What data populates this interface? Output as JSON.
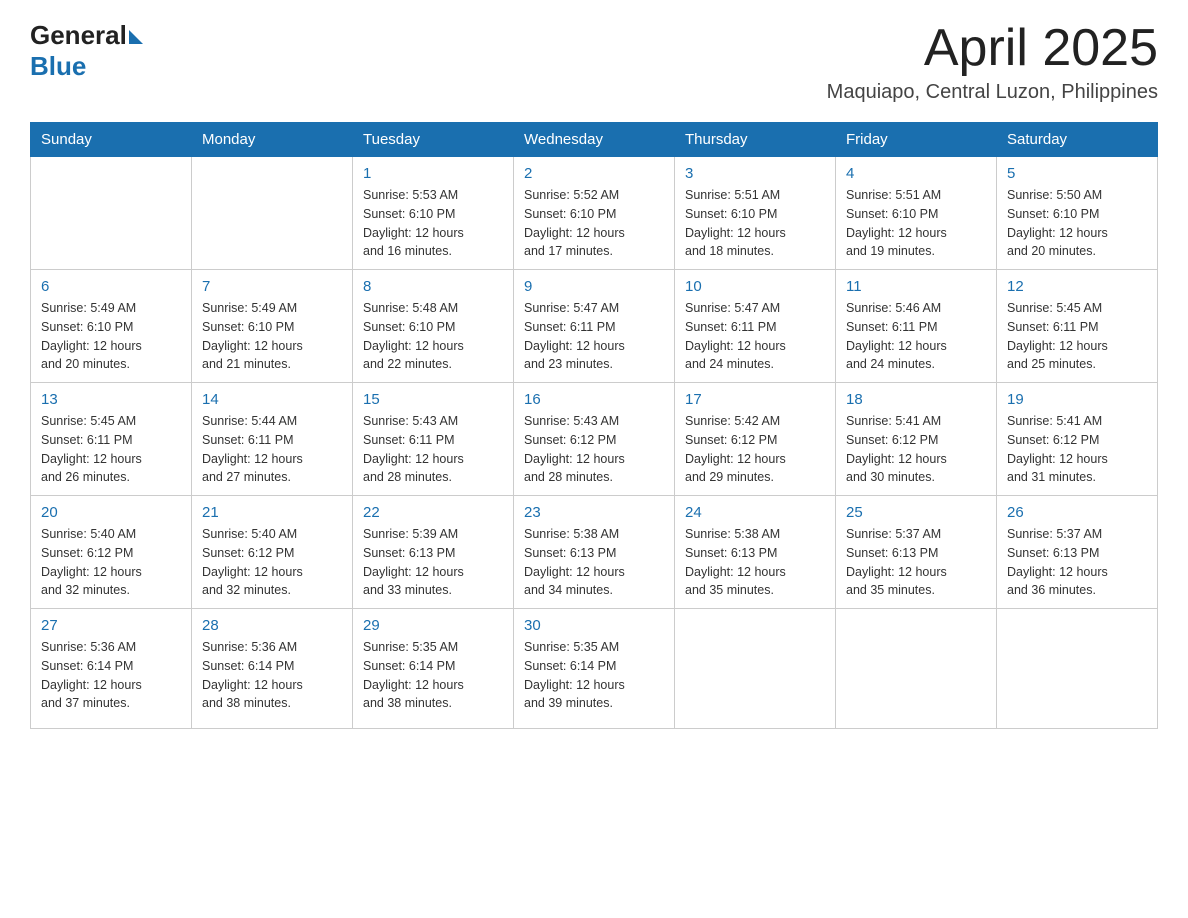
{
  "header": {
    "logo_general": "General",
    "logo_blue": "Blue",
    "month": "April 2025",
    "location": "Maquiapo, Central Luzon, Philippines"
  },
  "weekdays": [
    "Sunday",
    "Monday",
    "Tuesday",
    "Wednesday",
    "Thursday",
    "Friday",
    "Saturday"
  ],
  "weeks": [
    [
      {
        "day": "",
        "info": ""
      },
      {
        "day": "",
        "info": ""
      },
      {
        "day": "1",
        "info": "Sunrise: 5:53 AM\nSunset: 6:10 PM\nDaylight: 12 hours\nand 16 minutes."
      },
      {
        "day": "2",
        "info": "Sunrise: 5:52 AM\nSunset: 6:10 PM\nDaylight: 12 hours\nand 17 minutes."
      },
      {
        "day": "3",
        "info": "Sunrise: 5:51 AM\nSunset: 6:10 PM\nDaylight: 12 hours\nand 18 minutes."
      },
      {
        "day": "4",
        "info": "Sunrise: 5:51 AM\nSunset: 6:10 PM\nDaylight: 12 hours\nand 19 minutes."
      },
      {
        "day": "5",
        "info": "Sunrise: 5:50 AM\nSunset: 6:10 PM\nDaylight: 12 hours\nand 20 minutes."
      }
    ],
    [
      {
        "day": "6",
        "info": "Sunrise: 5:49 AM\nSunset: 6:10 PM\nDaylight: 12 hours\nand 20 minutes."
      },
      {
        "day": "7",
        "info": "Sunrise: 5:49 AM\nSunset: 6:10 PM\nDaylight: 12 hours\nand 21 minutes."
      },
      {
        "day": "8",
        "info": "Sunrise: 5:48 AM\nSunset: 6:10 PM\nDaylight: 12 hours\nand 22 minutes."
      },
      {
        "day": "9",
        "info": "Sunrise: 5:47 AM\nSunset: 6:11 PM\nDaylight: 12 hours\nand 23 minutes."
      },
      {
        "day": "10",
        "info": "Sunrise: 5:47 AM\nSunset: 6:11 PM\nDaylight: 12 hours\nand 24 minutes."
      },
      {
        "day": "11",
        "info": "Sunrise: 5:46 AM\nSunset: 6:11 PM\nDaylight: 12 hours\nand 24 minutes."
      },
      {
        "day": "12",
        "info": "Sunrise: 5:45 AM\nSunset: 6:11 PM\nDaylight: 12 hours\nand 25 minutes."
      }
    ],
    [
      {
        "day": "13",
        "info": "Sunrise: 5:45 AM\nSunset: 6:11 PM\nDaylight: 12 hours\nand 26 minutes."
      },
      {
        "day": "14",
        "info": "Sunrise: 5:44 AM\nSunset: 6:11 PM\nDaylight: 12 hours\nand 27 minutes."
      },
      {
        "day": "15",
        "info": "Sunrise: 5:43 AM\nSunset: 6:11 PM\nDaylight: 12 hours\nand 28 minutes."
      },
      {
        "day": "16",
        "info": "Sunrise: 5:43 AM\nSunset: 6:12 PM\nDaylight: 12 hours\nand 28 minutes."
      },
      {
        "day": "17",
        "info": "Sunrise: 5:42 AM\nSunset: 6:12 PM\nDaylight: 12 hours\nand 29 minutes."
      },
      {
        "day": "18",
        "info": "Sunrise: 5:41 AM\nSunset: 6:12 PM\nDaylight: 12 hours\nand 30 minutes."
      },
      {
        "day": "19",
        "info": "Sunrise: 5:41 AM\nSunset: 6:12 PM\nDaylight: 12 hours\nand 31 minutes."
      }
    ],
    [
      {
        "day": "20",
        "info": "Sunrise: 5:40 AM\nSunset: 6:12 PM\nDaylight: 12 hours\nand 32 minutes."
      },
      {
        "day": "21",
        "info": "Sunrise: 5:40 AM\nSunset: 6:12 PM\nDaylight: 12 hours\nand 32 minutes."
      },
      {
        "day": "22",
        "info": "Sunrise: 5:39 AM\nSunset: 6:13 PM\nDaylight: 12 hours\nand 33 minutes."
      },
      {
        "day": "23",
        "info": "Sunrise: 5:38 AM\nSunset: 6:13 PM\nDaylight: 12 hours\nand 34 minutes."
      },
      {
        "day": "24",
        "info": "Sunrise: 5:38 AM\nSunset: 6:13 PM\nDaylight: 12 hours\nand 35 minutes."
      },
      {
        "day": "25",
        "info": "Sunrise: 5:37 AM\nSunset: 6:13 PM\nDaylight: 12 hours\nand 35 minutes."
      },
      {
        "day": "26",
        "info": "Sunrise: 5:37 AM\nSunset: 6:13 PM\nDaylight: 12 hours\nand 36 minutes."
      }
    ],
    [
      {
        "day": "27",
        "info": "Sunrise: 5:36 AM\nSunset: 6:14 PM\nDaylight: 12 hours\nand 37 minutes."
      },
      {
        "day": "28",
        "info": "Sunrise: 5:36 AM\nSunset: 6:14 PM\nDaylight: 12 hours\nand 38 minutes."
      },
      {
        "day": "29",
        "info": "Sunrise: 5:35 AM\nSunset: 6:14 PM\nDaylight: 12 hours\nand 38 minutes."
      },
      {
        "day": "30",
        "info": "Sunrise: 5:35 AM\nSunset: 6:14 PM\nDaylight: 12 hours\nand 39 minutes."
      },
      {
        "day": "",
        "info": ""
      },
      {
        "day": "",
        "info": ""
      },
      {
        "day": "",
        "info": ""
      }
    ]
  ]
}
